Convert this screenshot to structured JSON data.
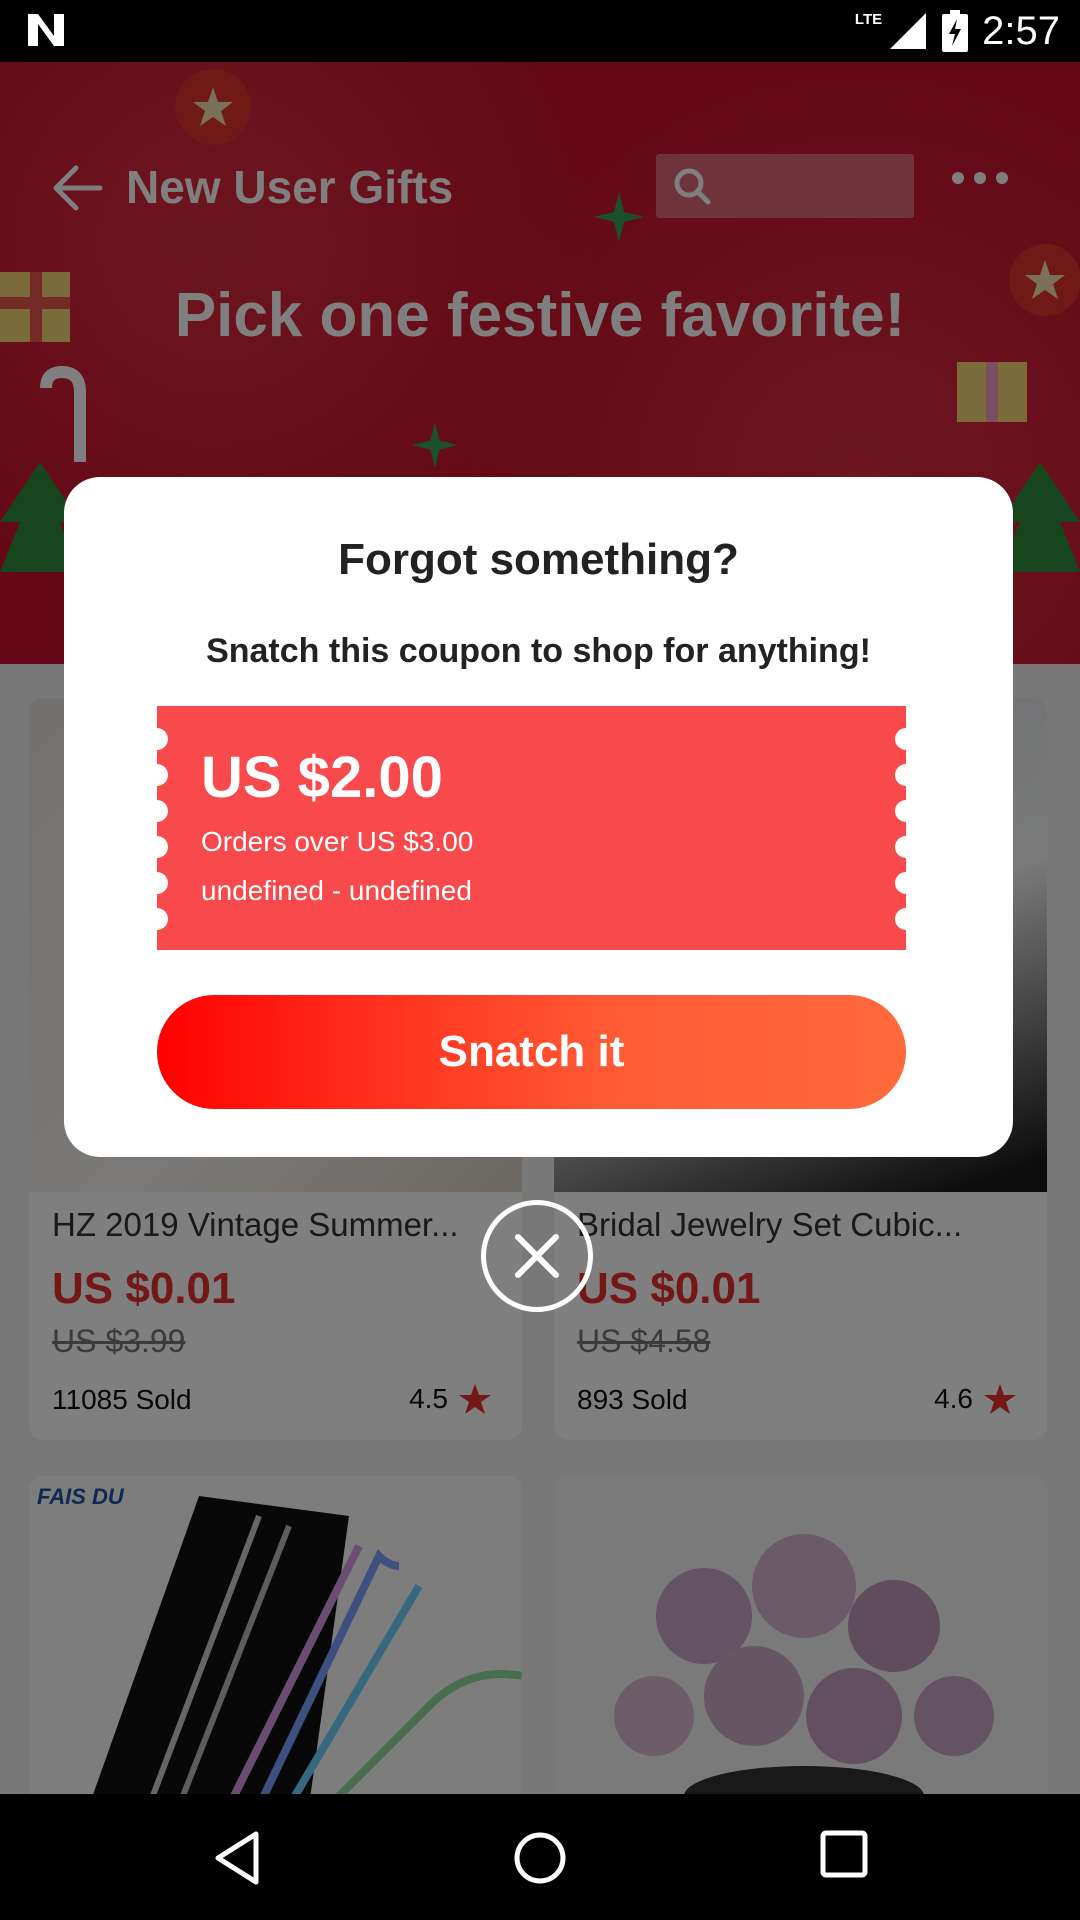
{
  "status_bar": {
    "network": "LTE",
    "time": "2:57"
  },
  "header": {
    "title": "New User Gifts",
    "search_placeholder": "",
    "banner_heading": "Pick one festive favorite!"
  },
  "products": [
    {
      "name": "HZ 2019 Vintage Summer...",
      "price": "US $0.01",
      "original_price": "US $3.99",
      "sold": "11085 Sold",
      "rating": "4.5"
    },
    {
      "name": "Bridal Jewelry Set Cubic...",
      "price": "US $0.01",
      "original_price": "US $4.58",
      "sold": "893 Sold",
      "rating": "4.6"
    },
    {
      "brand": "FAIS DU"
    },
    {}
  ],
  "modal": {
    "title": "Forgot something?",
    "subtitle": "Snatch this coupon to shop for anything!",
    "coupon": {
      "amount": "US $2.00",
      "condition": "Orders over US $3.00",
      "validity": "undefined - undefined"
    },
    "button_label": "Snatch it"
  },
  "colors": {
    "banner_red": "#c8102e",
    "coupon_red": "#f84a4c",
    "price_red": "#e62e2e",
    "button_gradient_start": "#ff0000",
    "button_gradient_end": "#ff6a3c"
  },
  "icons": [
    "n-logo-icon",
    "lte-signal-icon",
    "battery-charging-icon",
    "back-arrow-icon",
    "search-icon",
    "more-icon",
    "star-icon",
    "close-icon",
    "nav-back-icon",
    "nav-home-icon",
    "nav-recents-icon"
  ]
}
